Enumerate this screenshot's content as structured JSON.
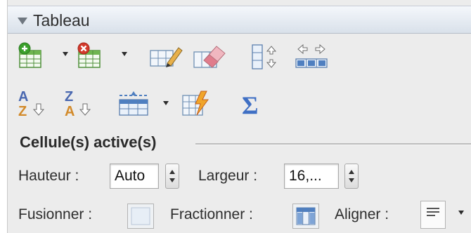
{
  "panel": {
    "title": "Tableau"
  },
  "toolbar": {
    "insert_table": "insert-table-icon",
    "delete_table": "delete-table-icon",
    "draw_table": "draw-table-icon",
    "eraser": "eraser-icon",
    "distribute_rows": "distribute-rows-icon",
    "distribute_columns": "distribute-columns-icon",
    "sort_ascending": "sort-ascending-icon",
    "sort_descending": "sort-descending-icon",
    "repeat_header": "repeat-header-row-icon",
    "autoformat": "table-autoformat-icon",
    "sum": "sum-icon"
  },
  "section": {
    "title": "Cellule(s) active(s)"
  },
  "cells": {
    "height_label": "Hauteur :",
    "height_value": "Auto",
    "width_label": "Largeur :",
    "width_value": "16,...",
    "merge_label": "Fusionner :",
    "split_label": "Fractionner :",
    "align_label": "Aligner :"
  },
  "colors": {
    "accent_green": "#3aa02b",
    "accent_red": "#d33a2c",
    "header_blue": "#d9e1ea"
  }
}
